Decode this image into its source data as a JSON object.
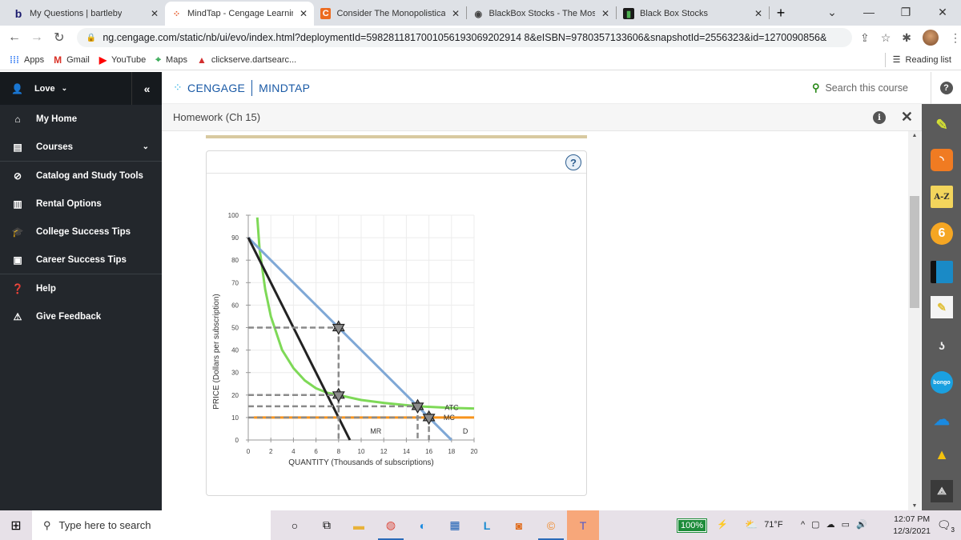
{
  "browser": {
    "tabs": [
      {
        "title": "My Questions | bartleby",
        "icon": "bartleby-b",
        "active": false
      },
      {
        "title": "MindTap - Cengage Learning",
        "icon": "cengage-dots",
        "active": true
      },
      {
        "title": "Consider The Monopolisticall",
        "icon": "chegg-c",
        "active": false
      },
      {
        "title": "BlackBox Stocks - The Most U",
        "icon": "globe",
        "active": false
      },
      {
        "title": "Black Box Stocks",
        "icon": "blackbox",
        "active": false
      }
    ],
    "new_tab": "+",
    "url": "ng.cengage.com/static/nb/ui/evo/index.html?deploymentId=5982811817001056193069202914 8&eISBN=9780357133606&snapshotId=2556323&id=1270090856&",
    "bookmarks": [
      {
        "label": "Apps",
        "icon": "apps-grid"
      },
      {
        "label": "Gmail",
        "icon": "gmail-m"
      },
      {
        "label": "YouTube",
        "icon": "youtube-play"
      },
      {
        "label": "Maps",
        "icon": "maps-pin"
      },
      {
        "label": "clickserve.dartsearc...",
        "icon": "dart-a"
      }
    ],
    "reading_list": "Reading list"
  },
  "sidebar": {
    "user": "Love",
    "items": [
      {
        "label": "My Home",
        "icon": "home-icon"
      },
      {
        "label": "Courses",
        "icon": "book-icon",
        "expandable": true
      },
      {
        "label": "Catalog and Study Tools",
        "icon": "compass-icon"
      },
      {
        "label": "Rental Options",
        "icon": "open-book-icon"
      },
      {
        "label": "College Success Tips",
        "icon": "grad-cap-icon"
      },
      {
        "label": "Career Success Tips",
        "icon": "briefcase-icon"
      },
      {
        "label": "Help",
        "icon": "help-icon"
      },
      {
        "label": "Give Feedback",
        "icon": "feedback-icon"
      }
    ]
  },
  "header": {
    "brand_left": "CENGAGE",
    "brand_right": "MINDTAP",
    "search_placeholder": "Search this course",
    "help": "?"
  },
  "activity": {
    "title": "Homework (Ch 15)",
    "panel_help": "?"
  },
  "toolbar_apps": [
    "highlighter",
    "rss",
    "a-z",
    "six-circle",
    "book",
    "notes",
    "read-aloud",
    "bongo",
    "onedrive",
    "google-drive",
    "cengage-tool"
  ],
  "toolbar_labels": {
    "az": "A-Z",
    "bongo": "bongo"
  },
  "chart_data": {
    "type": "line",
    "title": "",
    "xlabel": "QUANTITY (Thousands of subscriptions)",
    "ylabel": "PRICE (Dollars per subscription)",
    "xlim": [
      0,
      20
    ],
    "ylim": [
      0,
      100
    ],
    "xticks": [
      0,
      2,
      4,
      6,
      8,
      10,
      12,
      14,
      16,
      18,
      20
    ],
    "yticks": [
      0,
      10,
      20,
      30,
      40,
      50,
      60,
      70,
      80,
      90,
      100
    ],
    "grid": true,
    "series": [
      {
        "name": "D",
        "color": "#7fa8d6",
        "points": [
          [
            0,
            90
          ],
          [
            18,
            0
          ]
        ],
        "label_at": [
          19,
          4
        ]
      },
      {
        "name": "MR",
        "color": "#222222",
        "points": [
          [
            0,
            90
          ],
          [
            9,
            0
          ]
        ],
        "label_at": [
          10.8,
          4
        ]
      },
      {
        "name": "MC",
        "color": "#f7941d",
        "points": [
          [
            0.5,
            10
          ],
          [
            20,
            10
          ]
        ],
        "label_at": [
          17.3,
          10
        ]
      },
      {
        "name": "ATC",
        "color": "#7ed957",
        "points": [
          [
            0.8,
            99
          ],
          [
            1,
            85
          ],
          [
            1.5,
            67
          ],
          [
            2,
            55
          ],
          [
            3,
            40
          ],
          [
            4,
            32
          ],
          [
            5,
            26.5
          ],
          [
            6,
            23
          ],
          [
            7,
            21
          ],
          [
            8,
            20
          ],
          [
            10,
            17.8
          ],
          [
            12,
            16.5
          ],
          [
            15,
            15
          ],
          [
            18,
            14.3
          ],
          [
            20,
            14
          ]
        ],
        "label_at": [
          17.4,
          14.5
        ]
      }
    ],
    "markers": [
      {
        "x": 8,
        "y": 50
      },
      {
        "x": 8,
        "y": 20
      },
      {
        "x": 15,
        "y": 15
      },
      {
        "x": 16,
        "y": 10
      }
    ],
    "dashed_guides": [
      {
        "from": [
          0,
          50
        ],
        "to": [
          8,
          50
        ]
      },
      {
        "from": [
          8,
          50
        ],
        "to": [
          8,
          0
        ]
      },
      {
        "from": [
          0,
          20
        ],
        "to": [
          8,
          20
        ]
      },
      {
        "from": [
          0,
          15
        ],
        "to": [
          15,
          15
        ]
      },
      {
        "from": [
          15,
          15
        ],
        "to": [
          15,
          0
        ]
      },
      {
        "from": [
          0,
          10
        ],
        "to": [
          16,
          10
        ]
      },
      {
        "from": [
          16,
          10
        ],
        "to": [
          16,
          0
        ]
      }
    ]
  },
  "taskbar": {
    "search_placeholder": "Type here to search",
    "battery": "100%",
    "temperature": "71°F",
    "time": "12:07 PM",
    "date": "12/3/2021",
    "notifications": "3"
  }
}
